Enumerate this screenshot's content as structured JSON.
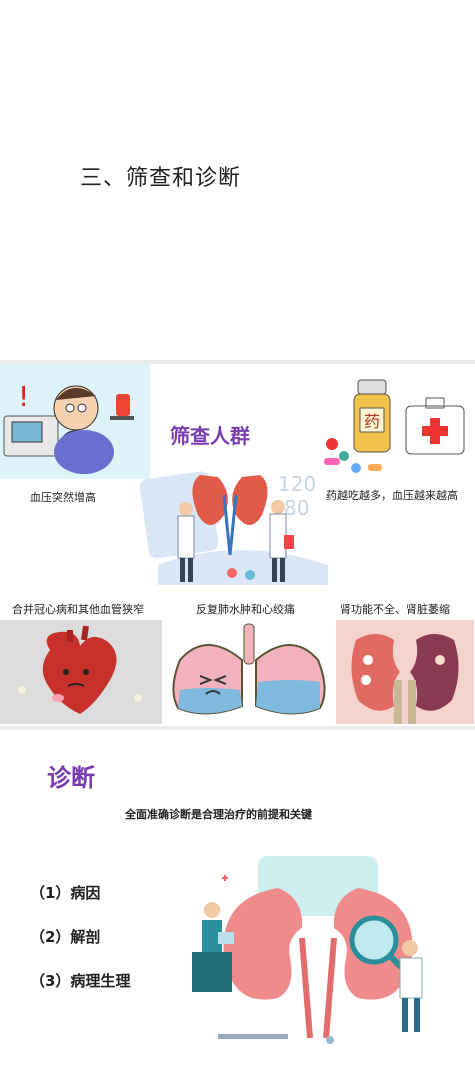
{
  "slide1": {
    "title": "三、筛查和诊断"
  },
  "slide2": {
    "title": "筛查人群",
    "captions": [
      "血压突然增高",
      "药越吃越多，血压越来越高",
      "合并冠心病和其他血管狭窄",
      "反复肺水肿和心绞痛",
      "肾功能不全、肾脏萎缩"
    ],
    "medicine_label": "药",
    "monitor_digits": [
      "120",
      "80"
    ]
  },
  "slide3": {
    "title": "诊断",
    "subtitle": "全面准确诊断是合理治疗的前提和关键",
    "items": [
      "（1）病因",
      "（2）解剖",
      "（3）病理生理"
    ]
  },
  "colors": {
    "accent_purple": "#7a3db1",
    "kidney_pink": "#f08b8b",
    "lung_pink": "#f3b2bd",
    "heart_red": "#c8302c"
  }
}
